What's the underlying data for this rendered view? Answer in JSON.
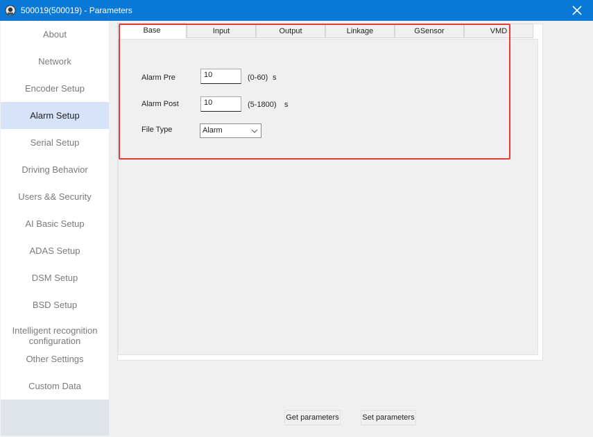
{
  "window": {
    "title": "500019(500019) - Parameters"
  },
  "sidebar": {
    "items": [
      {
        "label": "About"
      },
      {
        "label": "Network"
      },
      {
        "label": "Encoder Setup"
      },
      {
        "label": "Alarm Setup"
      },
      {
        "label": "Serial Setup"
      },
      {
        "label": "Driving Behavior"
      },
      {
        "label": "Users && Security"
      },
      {
        "label": "AI Basic Setup"
      },
      {
        "label": "ADAS Setup"
      },
      {
        "label": "DSM Setup"
      },
      {
        "label": "BSD Setup"
      },
      {
        "label": "Intelligent recognition configuration"
      },
      {
        "label": "Other Settings"
      },
      {
        "label": "Custom Data"
      }
    ],
    "active_index": 3
  },
  "tabs": [
    {
      "label": "Base"
    },
    {
      "label": "Input"
    },
    {
      "label": "Output"
    },
    {
      "label": "Linkage"
    },
    {
      "label": "GSensor"
    },
    {
      "label": "VMD"
    }
  ],
  "form": {
    "alarm_pre": {
      "label": "Alarm Pre",
      "value": "10",
      "range": "(0-60)",
      "unit": "s"
    },
    "alarm_post": {
      "label": "Alarm Post",
      "value": "10",
      "range": "(5-1800)",
      "unit": "s"
    },
    "file_type": {
      "label": "File Type",
      "value": "Alarm"
    }
  },
  "buttons": {
    "get": "Get parameters",
    "set": "Set parameters"
  },
  "colors": {
    "titlebar": "#0a78d7",
    "highlight_border": "#e53a35",
    "sidebar_active": "#d6e3f8"
  }
}
